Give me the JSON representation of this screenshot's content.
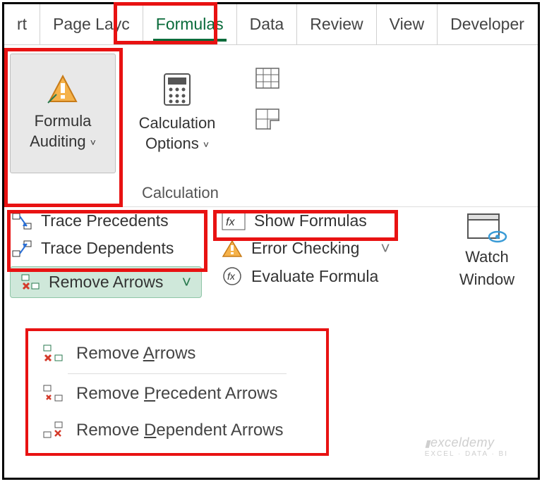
{
  "tabs": {
    "insert_partial": "rt",
    "page_layout": "Page Layc",
    "formulas": "Formulas",
    "data": "Data",
    "review": "Review",
    "view": "View",
    "developer": "Developer"
  },
  "ribbon": {
    "formula_auditing": "Formula Auditing",
    "formula_auditing_chev": "˅",
    "calculation_options": "Calculation Options",
    "calculation_options_chev": "˅",
    "group_label": "Calculation"
  },
  "auditing": {
    "trace_precedents": "Trace Precedents",
    "trace_dependents": "Trace Dependents",
    "remove_arrows": "Remove Arrows",
    "show_formulas": "Show Formulas",
    "error_checking": "Error Checking",
    "error_checking_chev": "˅",
    "evaluate_formula": "Evaluate Formula",
    "watch_window": "Watch Window"
  },
  "menu": {
    "remove_arrows_pre": "Remove ",
    "remove_arrows_u": "A",
    "remove_arrows_post": "rrows",
    "remove_precedent_pre": "Remove ",
    "remove_precedent_u": "P",
    "remove_precedent_post": "recedent Arrows",
    "remove_dependent_pre": "Remove ",
    "remove_dependent_u": "D",
    "remove_dependent_post": "ependent Arrows"
  },
  "watermark": {
    "brand": "exceldemy",
    "tag": "EXCEL · DATA · BI"
  }
}
